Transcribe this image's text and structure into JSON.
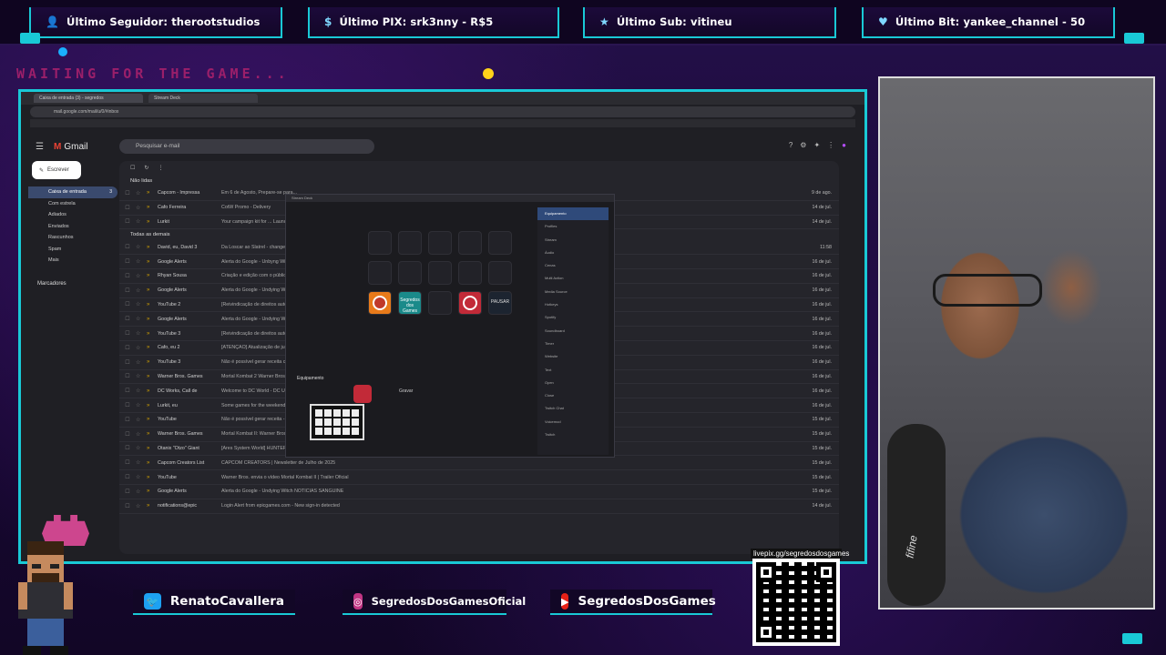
{
  "alerts": {
    "follower": "Último Seguidor: therootstudios",
    "pix": "Último PIX: srk3nny - R$5",
    "sub": "Último Sub: vitineu",
    "bit": "Último Bit: yankee_channel - 50"
  },
  "waiting_text": "WAITING FOR THE GAME...",
  "browser": {
    "tabs": [
      "Caixa de entrada (3) - segredos",
      "Stream Deck"
    ],
    "url": "mail.google.com/mail/u/0/#inbox"
  },
  "gmail": {
    "logo_label": "Gmail",
    "search_placeholder": "Pesquisar e-mail",
    "compose_label": "Escrever",
    "sidebar": [
      {
        "label": "Caixa de entrada",
        "count": "3"
      },
      {
        "label": "Com estrela",
        "count": ""
      },
      {
        "label": "Adiados",
        "count": ""
      },
      {
        "label": "Enviados",
        "count": ""
      },
      {
        "label": "Rascunhos",
        "count": ""
      },
      {
        "label": "Spam",
        "count": ""
      },
      {
        "label": "Mais",
        "count": ""
      }
    ],
    "labels_heading": "Marcadores",
    "section_unread": "Não lidas",
    "section_all": "Todas as demais",
    "rows": [
      {
        "from": "Capcom - Impressa",
        "subject": "Em 6 de Agosto, Prepare-se para...",
        "date": "9 de ago."
      },
      {
        "from": "Cafo Ferreira",
        "subject": "CotW Promo - Delivery",
        "date": "14 de jul."
      },
      {
        "from": "Lurkit",
        "subject": "Your campaign kit for ... Launch Access Guide",
        "date": "14 de jul."
      },
      {
        "from": "David, eu, David 3",
        "subject": "Da Loscar ao Slatrel - changes made to the videos for the redubbing",
        "date": "11:58"
      },
      {
        "from": "Google Alerts",
        "subject": "Alerta do Google - Unbyng Witch - Nova atualização",
        "date": "16 de jul."
      },
      {
        "from": "Rhyan Sousa",
        "subject": "Criação e edição com o público",
        "date": "16 de jul."
      },
      {
        "from": "Google Alerts",
        "subject": "Alerta do Google - Undying Witch, latest updates",
        "date": "16 de jul."
      },
      {
        "from": "YouTube 2",
        "subject": "[Reivindicação de direitos autorais]",
        "date": "16 de jul."
      },
      {
        "from": "Google Alerts",
        "subject": "Alerta do Google - Undying Witch - Shadow Stop",
        "date": "16 de jul."
      },
      {
        "from": "YouTube 3",
        "subject": "[Reivindicação de direitos autorais] Mortal Kombat 2",
        "date": "16 de jul."
      },
      {
        "from": "Cafo, eu 2",
        "subject": "[ATENÇÃO] Atualização de jul. de 2025 às 11:03",
        "date": "16 de jul."
      },
      {
        "from": "YouTube 3",
        "subject": "Não é possível gerar receita com este vídeo",
        "date": "16 de jul."
      },
      {
        "from": "Warner Bros. Games",
        "subject": "Mortal Kombat 2 Warner Bros. Pictures",
        "date": "16 de jul."
      },
      {
        "from": "DC Works, Call de",
        "subject": "Welcome to DC World - DC Universe",
        "date": "16 de jul."
      },
      {
        "from": "Lurkit, eu",
        "subject": "Some games for the weekend - Ready or Not",
        "date": "16 de jul."
      },
      {
        "from": "YouTube",
        "subject": "Não é possível gerar receita - Unbyng",
        "date": "15 de jul."
      },
      {
        "from": "Warner Bros. Games",
        "subject": "Mortal Kombat II: Warner Bros. Pictures lança primeiro trailer",
        "date": "15 de jul."
      },
      {
        "from": "Otanix \"Otzo\" Giant",
        "subject": "[Ares System World] HUNTERxHUNTER NENIMPACT já está disponível",
        "date": "15 de jul."
      },
      {
        "from": "Capcom Creators List",
        "subject": "CAPCOM CREATORS | Newsletter de Julho de 2025",
        "date": "15 de jul."
      },
      {
        "from": "YouTube",
        "subject": "Warner Bros. envia o vídeo Mortal Kombat II | Trailer Oficial",
        "date": "15 de jul."
      },
      {
        "from": "Google Alerts",
        "subject": "Alerta do Google - Undying Witch NOTÍCIAS SANGUINE",
        "date": "15 de jul."
      },
      {
        "from": "notifications@epic",
        "subject": "Login Alert from epicgames.com - New sign-in detected",
        "date": "14 de jul."
      }
    ]
  },
  "deck": {
    "title": "Stream Deck",
    "keys": [
      "",
      "",
      "",
      "",
      "",
      "",
      "",
      "",
      "",
      "",
      "record",
      "Segredos dos Games",
      "",
      "stop",
      "PAUSAR"
    ],
    "profile_list": [
      "Equipamento",
      "Profiles",
      "Stream",
      "Áudio",
      "Cenas",
      "Multi Action",
      "Media Source",
      "Hotkeys",
      "Spotify",
      "Soundboard",
      "Timer",
      "Website",
      "Text",
      "Open",
      "Close",
      "Twitch Chat",
      "Voicemod",
      "Twitch"
    ],
    "section_label": "Equipamento",
    "action_label": "Gravar"
  },
  "socials": {
    "twitter": "RenatoCavallera",
    "instagram": "SegredosDosGamesOficial",
    "youtube": "SegredosDosGames"
  },
  "qr_label": "livepix.gg/segredosdosgames",
  "mic_brand": "fifine",
  "colors": {
    "accent": "#19c9d6",
    "background": "#1a0a2e",
    "waiting": "#9b1f6a"
  }
}
